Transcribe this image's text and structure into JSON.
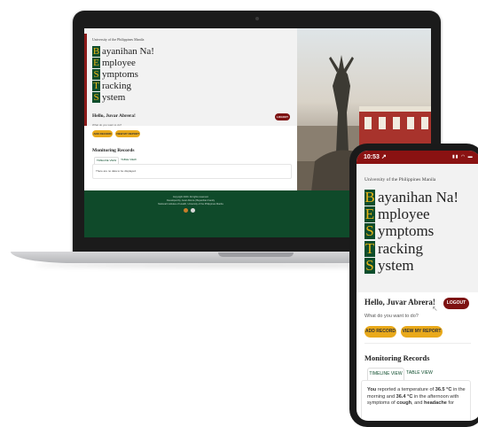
{
  "laptop_page": {
    "university": "University of the Philippines Manila",
    "acronym": [
      {
        "letter": "B",
        "rest": "ayanihan Na!"
      },
      {
        "letter": "E",
        "rest": "mployee"
      },
      {
        "letter": "S",
        "rest": "ymptoms"
      },
      {
        "letter": "T",
        "rest": "racking"
      },
      {
        "letter": "S",
        "rest": "ystem"
      }
    ],
    "greeting": "Hello, Juvar Abrera!",
    "logout_label": "LOGOUT",
    "question": "What do you want to do?",
    "add_record_label": "ADD RECORD",
    "view_report_label": "VIEW MY REPORT",
    "monitoring_title": "Monitoring Records",
    "tab_timeline": "TIMELINE VIEW",
    "tab_table": "TABLE VIEW",
    "no_data_text": "There are no data to be displayed.",
    "footer_lines": [
      "Copyright 2020. All rights reserved.",
      "Developed by Juvar Abrera | Bayanihan Family",
      "National Institutes of Health, University of the Philippines Manila"
    ]
  },
  "phone_page": {
    "status_time": "10:53 ↗",
    "university": "University of the Philippines Manila",
    "acronym": [
      {
        "letter": "B",
        "rest": "ayanihan Na!"
      },
      {
        "letter": "E",
        "rest": "mployee"
      },
      {
        "letter": "S",
        "rest": "ymptoms"
      },
      {
        "letter": "T",
        "rest": "racking"
      },
      {
        "letter": "S",
        "rest": "ystem"
      }
    ],
    "greeting": "Hello, Juvar Abrera!",
    "logout_label": "LOGOUT",
    "question": "What do you want to do?",
    "add_record_label": "ADD RECORD",
    "view_report_label": "VIEW MY REPORT",
    "monitoring_title": "Monitoring Records",
    "tab_timeline": "TIMELINE VIEW",
    "tab_table": "TABLE VIEW",
    "timeline_entry": {
      "who": "You",
      "t1": " reported a temperature of ",
      "temp_morning": "36.5 °C",
      "t2": " in the morning and ",
      "temp_afternoon": "36.4 °C",
      "t3": " in the afternoon with symptoms of ",
      "symptom1": "cough",
      "t4": ", and ",
      "symptom2": "headache",
      "t5": " for"
    }
  },
  "colors": {
    "brand_green": "#0d4d2c",
    "brand_gold": "#e9b516",
    "button_gold": "#e9a91a",
    "logout_red": "#7d1212",
    "accent_red": "#8b1a1a"
  },
  "icons": [
    "oblation-statue-photo",
    "social-icon",
    "info-icon",
    "cursor-icon"
  ]
}
